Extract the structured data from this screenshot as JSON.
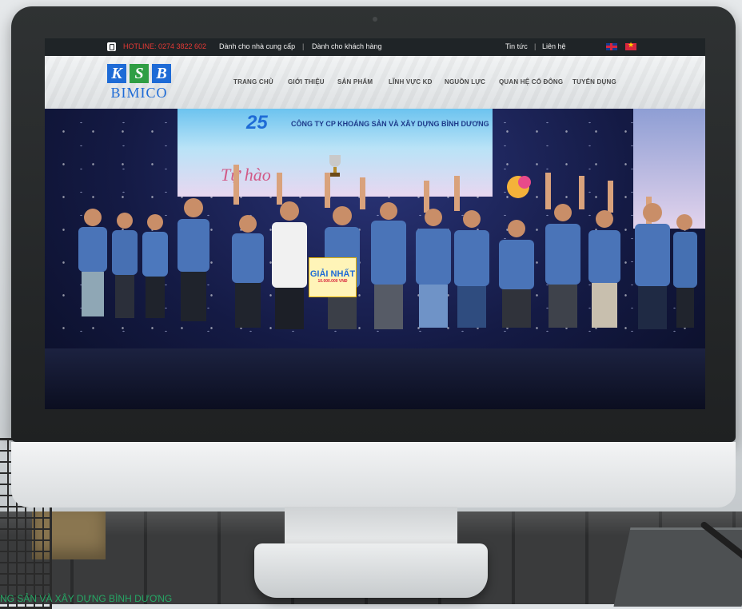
{
  "topbar": {
    "hotline": "HOTLINE: 0274 3822 602",
    "supplier_link": "Dành cho nhà cung cấp",
    "customer_link": "Dành cho khách hàng",
    "separator": "|",
    "news_link": "Tin tức",
    "contact_link": "Liên hệ"
  },
  "logo": {
    "letters": [
      "K",
      "S",
      "B"
    ],
    "name": "BIMICO"
  },
  "nav": {
    "items": [
      "TRANG CHỦ",
      "GIỚI THIỆU",
      "SẢN PHẨM",
      "LĨNH VỰC KD",
      "NGUỒN LỰC",
      "QUAN HỆ CỔ ĐÔNG",
      "TUYỂN DỤNG"
    ]
  },
  "banner": {
    "anniversary": "25",
    "company": "CÔNG TY CP KHOÁNG SẢN VÀ XÂY DỰNG BÌNH DƯƠNG",
    "slogan": "Tự hào",
    "prize_title": "GIẢI NHẤT",
    "prize_amount": "10.000.000 VNĐ"
  },
  "caption": "NG SẢN VÀ XÂY DỰNG BÌNH DƯƠNG",
  "colors": {
    "brand_blue": "#1e6bd6",
    "brand_green": "#2f9e44",
    "hotline_red": "#e53935",
    "caption_green": "#25a865"
  }
}
